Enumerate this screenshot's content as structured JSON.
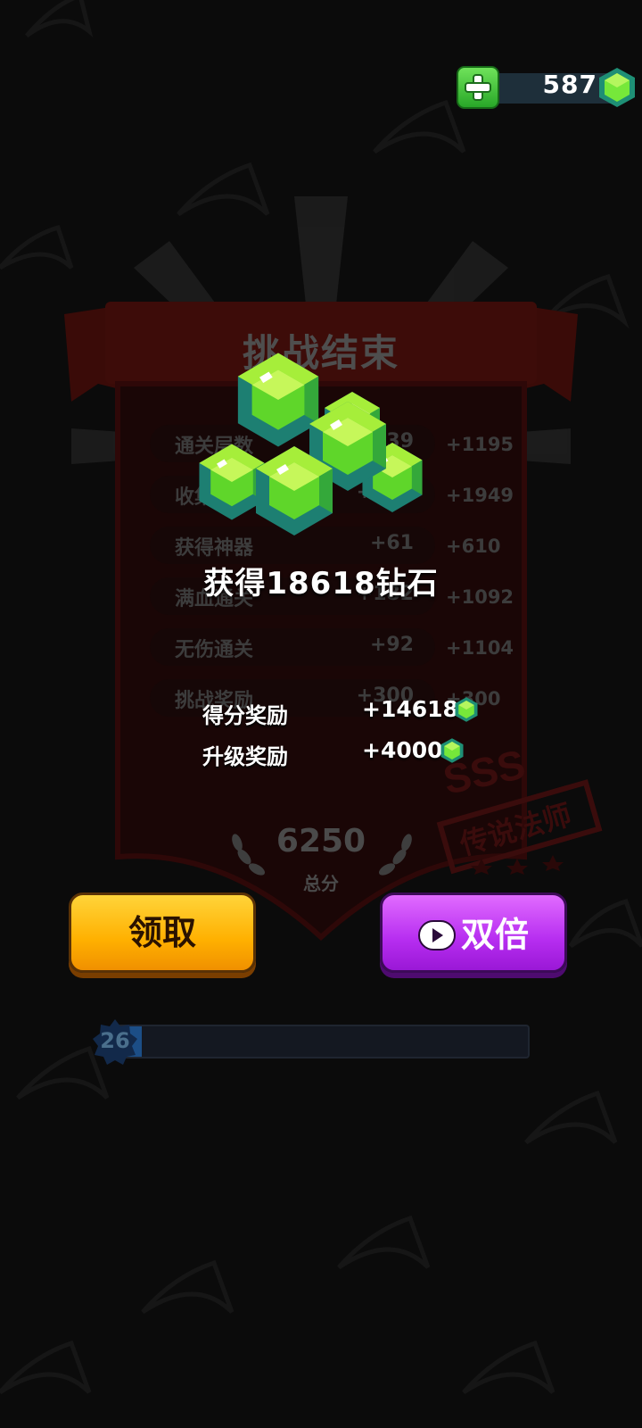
{
  "currency": {
    "gems": "587",
    "add_icon": "plus-icon",
    "gem_icon": "gem-icon"
  },
  "panel": {
    "title": "挑战结束",
    "rows": [
      {
        "label": "通关层数",
        "value": "+239",
        "total": "+1195"
      },
      {
        "label": "收集宝箱",
        "value": "+487",
        "total": "+1949"
      },
      {
        "label": "获得神器",
        "value": "+61",
        "total": "+610"
      },
      {
        "label": "满血通关",
        "value": "+182",
        "total": "+1092"
      },
      {
        "label": "无伤通关",
        "value": "+92",
        "total": "+1104"
      },
      {
        "label": "挑战奖励",
        "value": "+300",
        "total": "+300"
      }
    ],
    "score": "6250",
    "score_label": "总分",
    "stamp_grade": "SSS",
    "stamp_title": "传说法师"
  },
  "reward": {
    "headline": "获得18618钻石",
    "bonuses": [
      {
        "label": "得分奖励",
        "value": "+14618"
      },
      {
        "label": "升级奖励",
        "value": "+4000"
      }
    ]
  },
  "buttons": {
    "claim": "领取",
    "double": "双倍"
  },
  "level": {
    "number": "26",
    "progress": 0.07
  },
  "colors": {
    "gem_green": "#4ed52a",
    "claim_yellow": "#ffb000",
    "double_purple": "#b62df0",
    "level_blue": "#1c4e86"
  }
}
